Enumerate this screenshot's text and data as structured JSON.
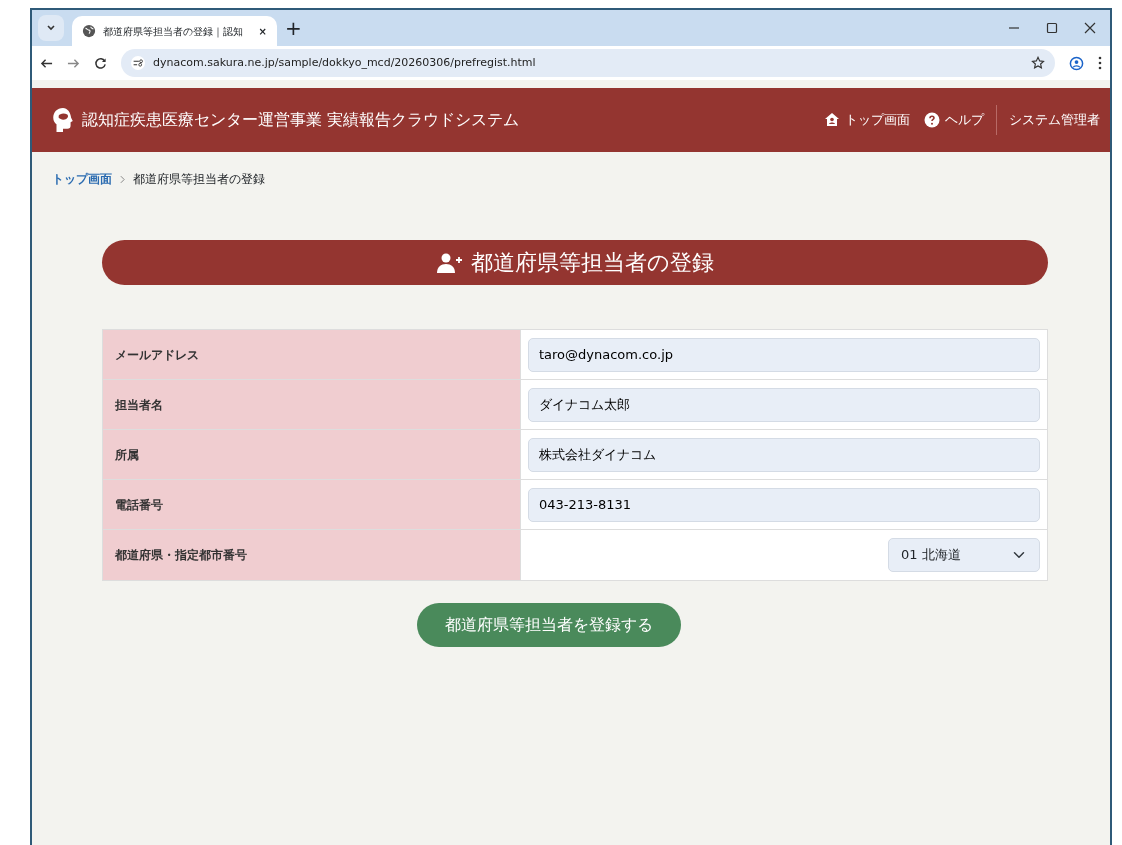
{
  "browser": {
    "tab_title": "都道府県等担当者の登録｜認知",
    "tab_close": "×",
    "new_tab": "+",
    "url": "dynacom.sakura.ne.jp/sample/dokkyo_mcd/20260306/prefregist.html"
  },
  "header": {
    "title": "認知症疾患医療センター運営事業 実績報告クラウドシステム",
    "nav": [
      {
        "label": "トップ画面",
        "kind": "home"
      },
      {
        "label": "ヘルプ",
        "kind": "help"
      }
    ],
    "user": "システム管理者"
  },
  "breadcrumb": [
    {
      "label": "トップ画面",
      "kind": "link"
    },
    {
      "label": "都道府県等担当者の登録",
      "kind": "current"
    }
  ],
  "page_title": "都道府県等担当者の登録",
  "form": [
    {
      "label": "メールアドレス",
      "kind": "text",
      "value": "taro@dynacom.co.jp"
    },
    {
      "label": "担当者名",
      "kind": "text",
      "value": "ダイナコム太郎"
    },
    {
      "label": "所属",
      "kind": "text",
      "value": "株式会社ダイナコム"
    },
    {
      "label": "電話番号",
      "kind": "text",
      "value": "043-213-8131"
    },
    {
      "label": "都道府県・指定都市番号",
      "kind": "select",
      "value": "01 北海道"
    }
  ],
  "submit": "都道府県等担当者を登録する"
}
